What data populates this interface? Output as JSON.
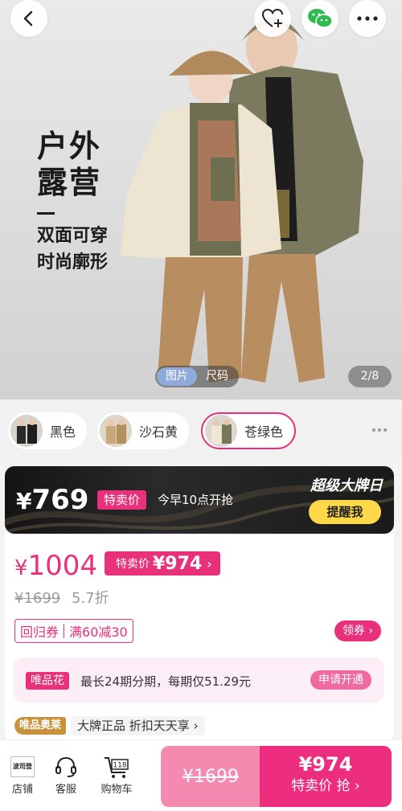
{
  "hero": {
    "slogan_line1": "户外",
    "slogan_line2": "露营",
    "slogan_line3": "双面可穿",
    "slogan_line4": "时尚廓形",
    "tabs": [
      "图片",
      "尺码"
    ],
    "active_tab": "图片",
    "counter": "2/8",
    "icons": {
      "back": "chevron-left-icon",
      "favorite": "heart-plus-icon",
      "share": "wechat-icon",
      "more": "more-dots-icon"
    }
  },
  "colors": {
    "options": [
      {
        "label": "黑色",
        "selected": false
      },
      {
        "label": "沙石黄",
        "selected": false
      },
      {
        "label": "苍绿色",
        "selected": true
      }
    ],
    "selected_color": "#e8317a"
  },
  "promo": {
    "price_symbol": "¥",
    "price": "769",
    "tag": "特卖价",
    "time_text": "今早10点开抢",
    "event": "超级大牌日",
    "remind_label": "提醒我"
  },
  "pricing": {
    "current_symbol": "¥",
    "current": "1004",
    "sale_label": "特卖价",
    "sale_price": "¥974",
    "original": "¥1699",
    "discount": "5.7折",
    "coupon_a": "回归券",
    "coupon_b": "满60减30",
    "get_coupon_label": "领券",
    "installment_tag": "唯品花",
    "installment_text": "最长24期分期，每期仅51.29元",
    "installment_apply": "申请开通",
    "guarantee_badge": "唯品奥莱",
    "guarantee_text": "大牌正品 折扣天天享"
  },
  "bottom": {
    "shop_logo_text": "波司登",
    "shop_label": "店铺",
    "service_label": "客服",
    "cart_label": "购物车",
    "cart_count": "118",
    "orig_price": "¥1699",
    "buy_price": "¥974",
    "buy_label": "特卖价 抢"
  },
  "accent": "#e8317a"
}
